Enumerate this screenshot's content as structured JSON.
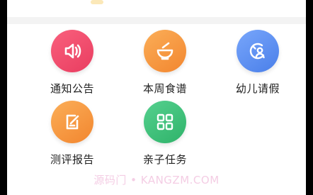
{
  "grid": {
    "items": [
      {
        "label": "通知公告",
        "icon": "speaker-icon",
        "color": "#f04e6e"
      },
      {
        "label": "本周食谱",
        "icon": "bowl-icon",
        "color": "#f79a43"
      },
      {
        "label": "幼儿请假",
        "icon": "user-leave-icon",
        "color": "#5a8ef1"
      },
      {
        "label": "测评报告",
        "icon": "edit-report-icon",
        "color": "#f79a43"
      },
      {
        "label": "亲子任务",
        "icon": "apps-grid-icon",
        "color": "#3fc27c"
      }
    ]
  },
  "watermark": {
    "text": "源码门 • KANGZM.COM"
  }
}
